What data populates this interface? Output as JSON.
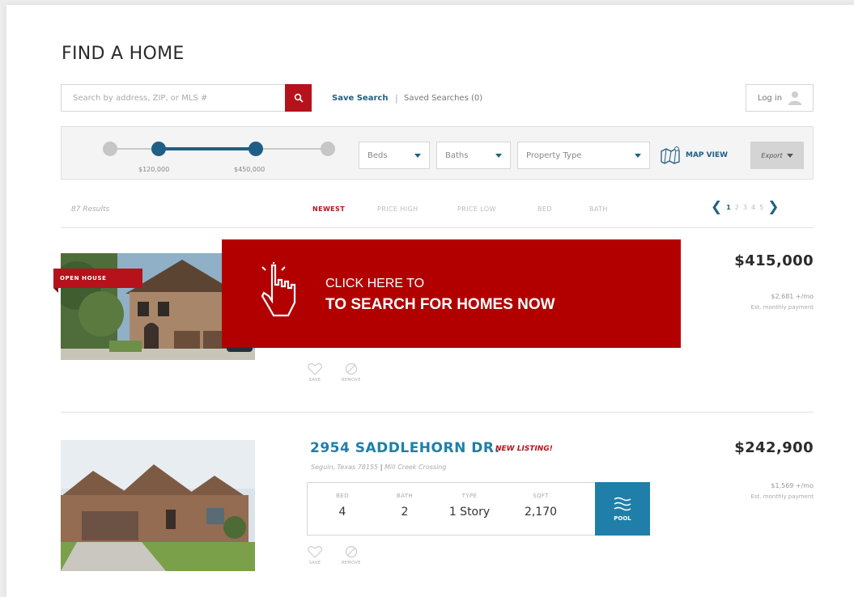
{
  "page": {
    "title": "FIND A HOME"
  },
  "search": {
    "placeholder": "Search by address, ZIP, or MLS #",
    "icon": "search-icon"
  },
  "saved": {
    "save_label": "Save Search",
    "saved_label": "Saved Searches (0)"
  },
  "login": {
    "label": "Log in",
    "icon": "user-icon"
  },
  "filters": {
    "price_min": "$120,000",
    "price_max": "$450,000",
    "beds": "Beds",
    "baths": "Baths",
    "property_type": "Property Type",
    "map_view": "MAP VIEW",
    "export": "Export"
  },
  "results": {
    "count": "87 Results",
    "sort_options": [
      "NEWEST",
      "PRICE HIGH",
      "PRICE LOW",
      "BED",
      "BATH"
    ],
    "active_sort": "NEWEST",
    "pages": [
      "1",
      "2",
      "3",
      "4",
      "5"
    ],
    "current_page": "1"
  },
  "listings": [
    {
      "badge": "OPEN HOUSE",
      "price": "$415,000",
      "monthly": "$2,681 +/mo",
      "monthly_label": "Est. monthly payment",
      "save": "SAVE",
      "remove": "REMOVE"
    },
    {
      "address": "2954 SADDLEHORN DR.",
      "tag": "NEW LISTING!",
      "city": "Seguin, Texas 78155",
      "subdivision": "Mill Creek Crossing",
      "bed_label": "BED",
      "bed": "4",
      "bath_label": "BATH",
      "bath": "2",
      "type_label": "TYPE",
      "type": "1 Story",
      "sqft_label": "SQFT",
      "sqft": "2,170",
      "feature": "POOL",
      "price": "$242,900",
      "monthly": "$1,569 +/mo",
      "monthly_label": "Est. monthly payment",
      "save": "SAVE",
      "remove": "REMOVE"
    }
  ],
  "overlay": {
    "line1": "CLICK HERE TO",
    "line2": "TO SEARCH FOR HOMES NOW",
    "icon": "pointer-hand-icon"
  },
  "colors": {
    "accent_red": "#b5121b",
    "brand_blue": "#1f5f86",
    "link_blue": "#1f7fa8",
    "overlay_red": "#b20000"
  }
}
